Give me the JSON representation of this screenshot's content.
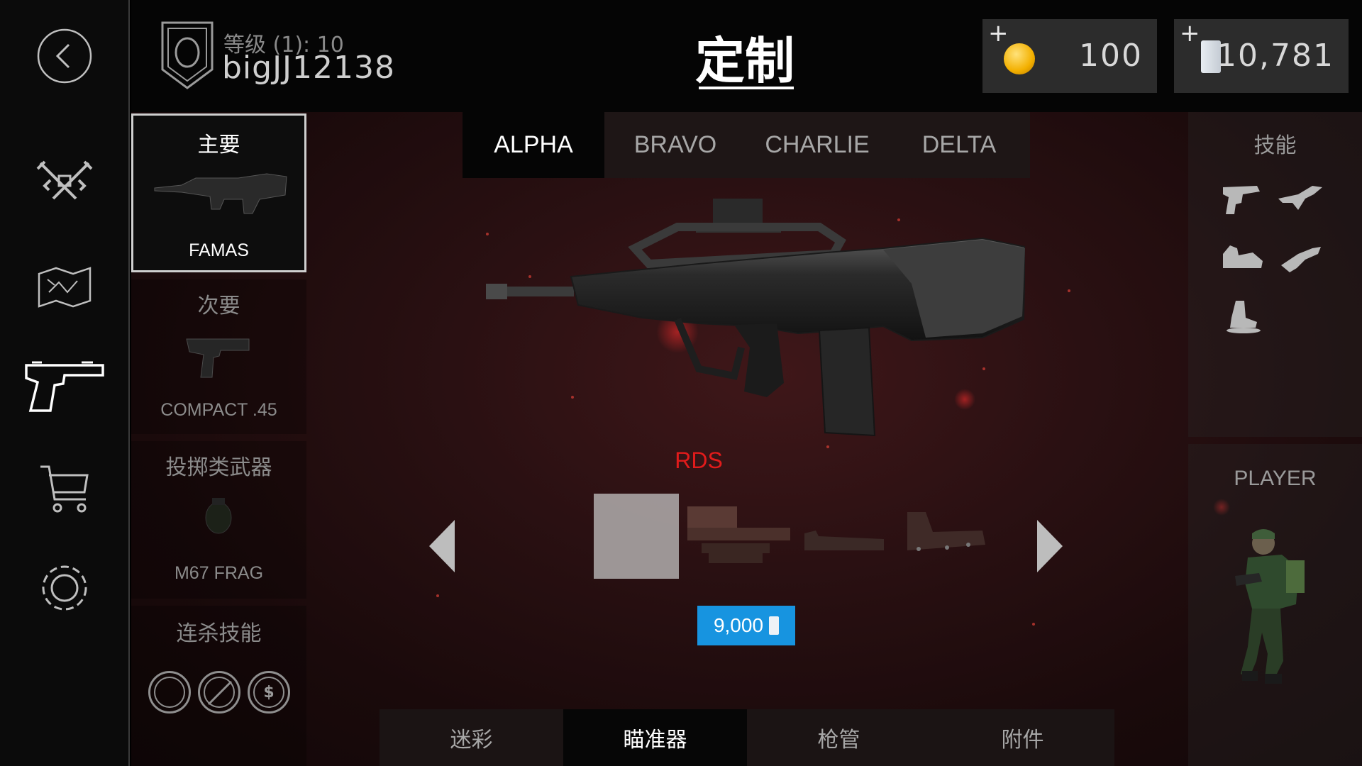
{
  "player": {
    "level_label": "等级 (1): 10",
    "username": "bigJJ12138"
  },
  "page_title": "定制",
  "currency": {
    "coins": {
      "plus": "+",
      "amount": "100"
    },
    "cash": {
      "plus": "+",
      "amount": "10,781"
    }
  },
  "nav": [
    "back-icon",
    "crossed-guns-icon",
    "map-icon",
    "pistol-icon",
    "cart-icon",
    "gear-icon"
  ],
  "slots": {
    "primary": {
      "header": "主要",
      "weapon": "FAMAS"
    },
    "secondary": {
      "header": "次要",
      "weapon": "COMPACT .45"
    },
    "throwable": {
      "header": "投掷类武器",
      "weapon": "M67 FRAG"
    },
    "killstreak": {
      "header": "连杀技能",
      "icons": [
        "drone-icon",
        "no-drone-icon",
        "dollar-icon"
      ]
    }
  },
  "loadout_tabs": [
    {
      "label": "ALPHA",
      "selected": true
    },
    {
      "label": "BRAVO",
      "selected": false
    },
    {
      "label": "CHARLIE",
      "selected": false
    },
    {
      "label": "DELTA",
      "selected": false
    }
  ],
  "skills": {
    "header": "技能",
    "icons": [
      "gun-icon",
      "eagle-icon",
      "backpack-icon",
      "gun-swap-icon",
      "boot-icon"
    ]
  },
  "player_panel": {
    "header": "PLAYER"
  },
  "attachment": {
    "name": "RDS",
    "price": "9,000",
    "items": [
      "empty-slot",
      "holographic-sight",
      "rail-mount",
      "red-dot-sight"
    ]
  },
  "categories": [
    {
      "label": "迷彩",
      "selected": false
    },
    {
      "label": "瞄准器",
      "selected": true
    },
    {
      "label": "枪管",
      "selected": false
    },
    {
      "label": "附件",
      "selected": false
    }
  ],
  "colors": {
    "accent_red": "#e11b1b",
    "price_blue": "#1794e0",
    "background": "#2a1012"
  }
}
